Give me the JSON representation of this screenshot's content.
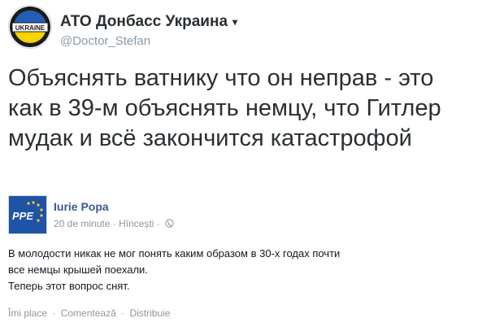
{
  "tweet": {
    "author_name": "АТО Донбасс Украина",
    "dropdown_glyph": "▾",
    "handle": "@Doctor_Stefan",
    "avatar_text": "UKRAINE",
    "text_lines": [
      "Объяснять ватнику что он неправ - это",
      "как в 39-м объяснять немцу, что Гитлер",
      "мудак и всё закончится катастрофой"
    ]
  },
  "fb_post": {
    "avatar_text": "PPE",
    "author_name": "Iurie Popa",
    "timestamp": "20 de minute",
    "location": "Hîncești",
    "separator": "·",
    "text_lines": [
      "В молодости никак не мог понять каким образом в 30-х годах почти",
      "все немцы крышей поехали.",
      "Теперь этот вопрос снят."
    ],
    "actions": [
      "Îmi place",
      "Comentează",
      "Distribuie"
    ]
  },
  "colors": {
    "fb_link": "#3b5998",
    "meta_gray": "#90949c",
    "text_dark": "#292f33"
  },
  "icons": [
    "avatar-emblem",
    "globe-icon",
    "ppe-logo"
  ]
}
